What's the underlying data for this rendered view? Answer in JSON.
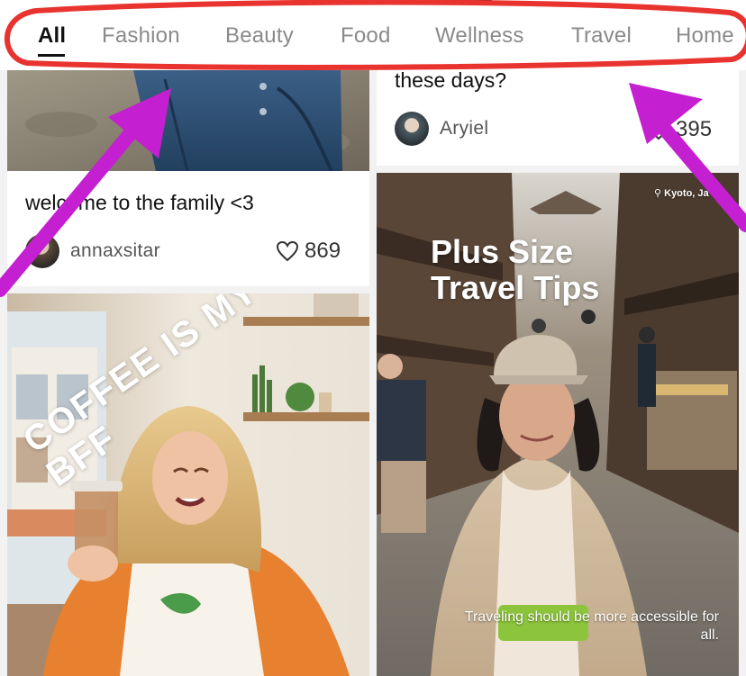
{
  "categories": {
    "tabs": [
      "All",
      "Fashion",
      "Beauty",
      "Food",
      "Wellness",
      "Travel",
      "Home"
    ],
    "active_tab": "All"
  },
  "cards": [
    {
      "id": "left-top",
      "title": "welcome to the family <3",
      "username": "annaxsitar",
      "likes": "869"
    },
    {
      "id": "right-top",
      "title": "these days?",
      "username": "Aryiel",
      "likes": "395"
    },
    {
      "id": "left-bottom",
      "overlay_text": "COFFEE IS MY BFF"
    },
    {
      "id": "right-bottom",
      "overlay_title": "Plus Size Travel Tips",
      "location": "Kyoto, Ja",
      "caption": "Traveling should be more accessible for all."
    }
  ],
  "colors": {
    "annotation_red": "#e8332f",
    "annotation_purple": "#c41fd0",
    "accent_text": "#111111"
  }
}
